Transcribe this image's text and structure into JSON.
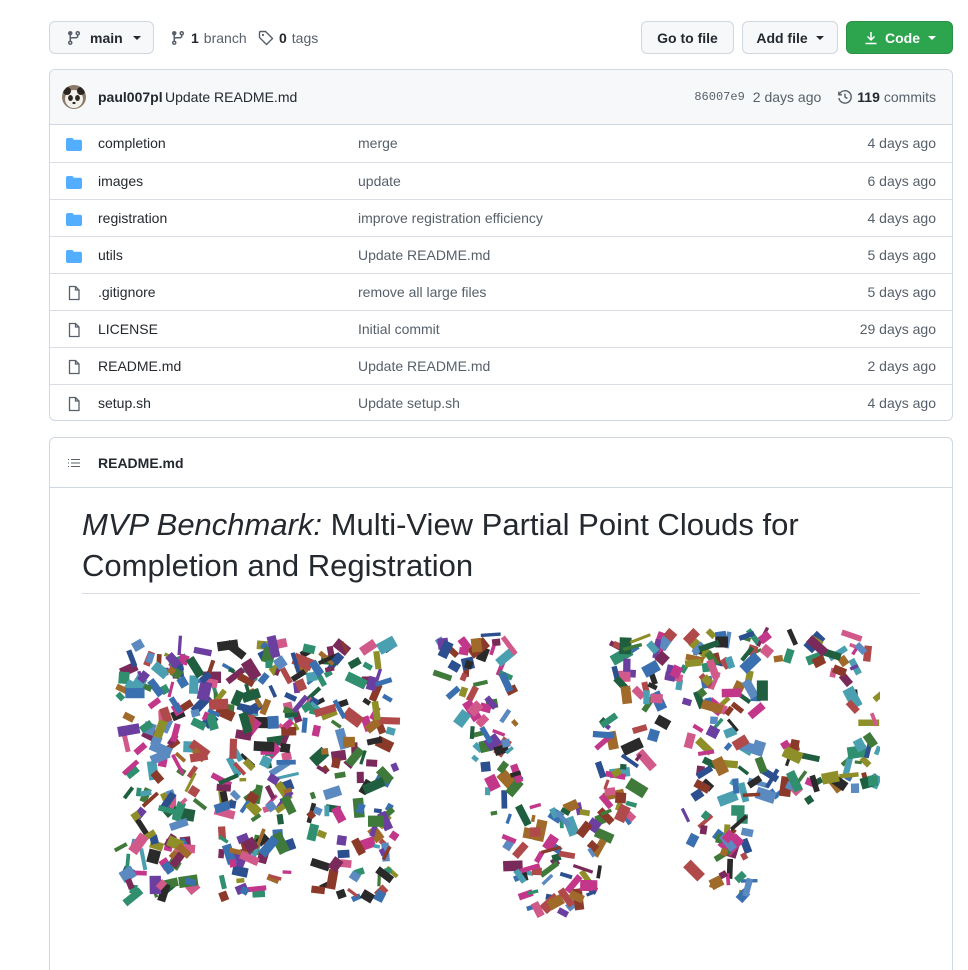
{
  "toolbar": {
    "branch_label": "main",
    "branch_count": "1",
    "branch_word": "branch",
    "tag_count": "0",
    "tag_word": "tags",
    "go_to_file": "Go to file",
    "add_file": "Add file",
    "code": "Code"
  },
  "commit": {
    "author": "paul007pl",
    "message": "Update README.md",
    "sha": "86007e9",
    "age": "2 days ago",
    "commit_count": "119",
    "commit_word": "commits"
  },
  "files": [
    {
      "type": "folder",
      "name": "completion",
      "message": "merge",
      "age": "4 days ago"
    },
    {
      "type": "folder",
      "name": "images",
      "message": "update",
      "age": "6 days ago"
    },
    {
      "type": "folder",
      "name": "registration",
      "message": "improve registration efficiency",
      "age": "4 days ago"
    },
    {
      "type": "folder",
      "name": "utils",
      "message": "Update README.md",
      "age": "5 days ago"
    },
    {
      "type": "file",
      "name": ".gitignore",
      "message": "remove all large files",
      "age": "5 days ago"
    },
    {
      "type": "file",
      "name": "LICENSE",
      "message": "Initial commit",
      "age": "29 days ago"
    },
    {
      "type": "file",
      "name": "README.md",
      "message": "Update README.md",
      "age": "2 days ago"
    },
    {
      "type": "file",
      "name": "setup.sh",
      "message": "Update setup.sh",
      "age": "4 days ago"
    }
  ],
  "readme": {
    "header_title": "README.md",
    "title_italic": "MVP Benchmark:",
    "title_rest": " Multi-View Partial Point Clouds for Completion and Registration",
    "image_alt": "MVP"
  },
  "colors": {
    "folder": "#54aeff",
    "file_icon": "#57606a",
    "code_button": "#2da44e"
  }
}
